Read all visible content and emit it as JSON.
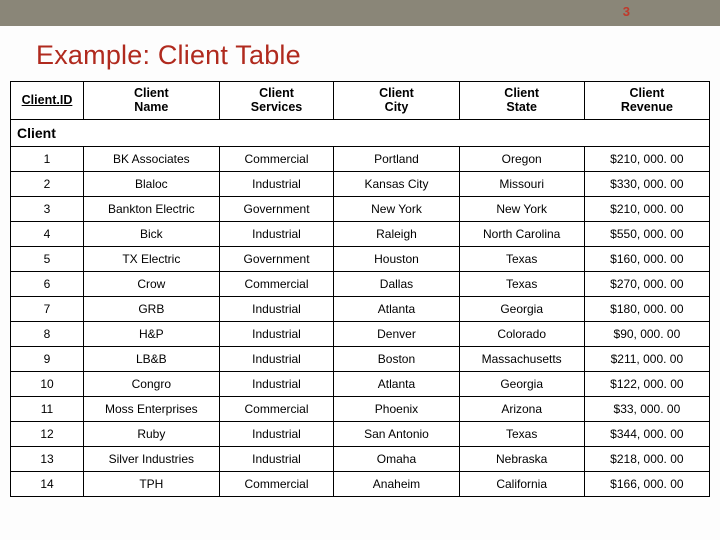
{
  "page_number": "3",
  "title": "Example: Client Table",
  "table_caption": "Client",
  "columns": {
    "id_label_1": "Client.",
    "id_label_2": "ID",
    "name_1": "Client",
    "name_2": "Name",
    "serv_1": "Client",
    "serv_2": "Services",
    "city_1": "Client",
    "city_2": "City",
    "state_1": "Client",
    "state_2": "State",
    "rev_1": "Client",
    "rev_2": "Revenue"
  },
  "rows": [
    {
      "id": "1",
      "name": "BK Associates",
      "services": "Commercial",
      "city": "Portland",
      "state": "Oregon",
      "revenue": "$210, 000. 00"
    },
    {
      "id": "2",
      "name": "Blaloc",
      "services": "Industrial",
      "city": "Kansas City",
      "state": "Missouri",
      "revenue": "$330, 000. 00"
    },
    {
      "id": "3",
      "name": "Bankton Electric",
      "services": "Government",
      "city": "New York",
      "state": "New York",
      "revenue": "$210, 000. 00"
    },
    {
      "id": "4",
      "name": "Bick",
      "services": "Industrial",
      "city": "Raleigh",
      "state": "North Carolina",
      "revenue": "$550, 000. 00"
    },
    {
      "id": "5",
      "name": "TX Electric",
      "services": "Government",
      "city": "Houston",
      "state": "Texas",
      "revenue": "$160, 000. 00"
    },
    {
      "id": "6",
      "name": "Crow",
      "services": "Commercial",
      "city": "Dallas",
      "state": "Texas",
      "revenue": "$270, 000. 00"
    },
    {
      "id": "7",
      "name": "GRB",
      "services": "Industrial",
      "city": "Atlanta",
      "state": "Georgia",
      "revenue": "$180, 000. 00"
    },
    {
      "id": "8",
      "name": "H&P",
      "services": "Industrial",
      "city": "Denver",
      "state": "Colorado",
      "revenue": "$90, 000. 00"
    },
    {
      "id": "9",
      "name": "LB&B",
      "services": "Industrial",
      "city": "Boston",
      "state": "Massachusetts",
      "revenue": "$211, 000. 00"
    },
    {
      "id": "10",
      "name": "Congro",
      "services": "Industrial",
      "city": "Atlanta",
      "state": "Georgia",
      "revenue": "$122, 000. 00"
    },
    {
      "id": "11",
      "name": "Moss Enterprises",
      "services": "Commercial",
      "city": "Phoenix",
      "state": "Arizona",
      "revenue": "$33, 000. 00"
    },
    {
      "id": "12",
      "name": "Ruby",
      "services": "Industrial",
      "city": "San Antonio",
      "state": "Texas",
      "revenue": "$344, 000. 00"
    },
    {
      "id": "13",
      "name": "Silver Industries",
      "services": "Industrial",
      "city": "Omaha",
      "state": "Nebraska",
      "revenue": "$218, 000. 00"
    },
    {
      "id": "14",
      "name": "TPH",
      "services": "Commercial",
      "city": "Anaheim",
      "state": "California",
      "revenue": "$166, 000. 00"
    }
  ]
}
